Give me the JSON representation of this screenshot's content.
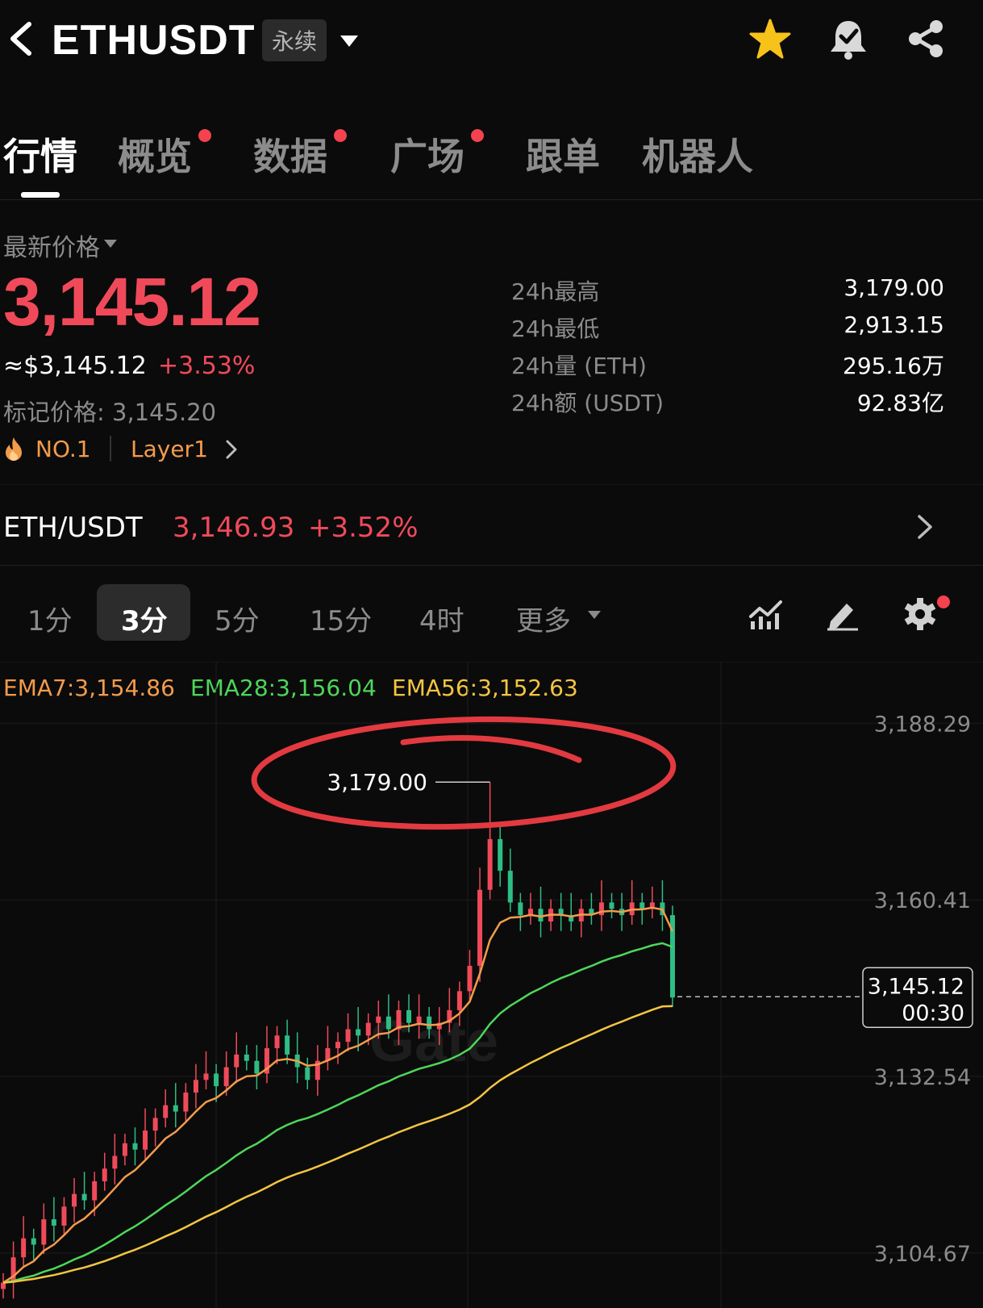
{
  "header": {
    "symbol": "ETHUSDT",
    "badge": "永续",
    "icons": [
      "back-icon",
      "dropdown-icon",
      "star-icon",
      "bell-check-icon",
      "share-icon"
    ]
  },
  "tabs": [
    {
      "label": "行情",
      "active": true,
      "dot": false
    },
    {
      "label": "概览",
      "active": false,
      "dot": true
    },
    {
      "label": "数据",
      "active": false,
      "dot": true
    },
    {
      "label": "广场",
      "active": false,
      "dot": true
    },
    {
      "label": "跟单",
      "active": false,
      "dot": false
    },
    {
      "label": "机器人",
      "active": false,
      "dot": false
    }
  ],
  "price": {
    "latest_label": "最新价格",
    "last": "3,145.12",
    "usd": "≈$3,145.12",
    "change_pct": "+3.53%",
    "mark": "标记价格: 3,145.20",
    "rank": "NO.1",
    "category": "Layer1"
  },
  "stats": [
    {
      "label": "24h最高",
      "value": "3,179.00"
    },
    {
      "label": "24h最低",
      "value": "2,913.15"
    },
    {
      "label": "24h量 (ETH)",
      "value": "295.16万"
    },
    {
      "label": "24h额 (USDT)",
      "value": "92.83亿"
    }
  ],
  "spot": {
    "pair": "ETH/USDT",
    "price": "3,146.93",
    "change_pct": "+3.52%"
  },
  "intervals": {
    "items": [
      "1分",
      "3分",
      "5分",
      "15分",
      "4时"
    ],
    "selected": "3分",
    "more": "更多"
  },
  "toolbar_icons": [
    "indicator-icon",
    "draw-icon",
    "gear-icon"
  ],
  "colors": {
    "up": "#f04a5a",
    "down": "#2ebd85",
    "ema7": "#f39b4c",
    "ema28": "#4ed65a",
    "ema56": "#f5c542",
    "accent_dot": "#f4424f",
    "star": "#f7c21a"
  },
  "chart_data": {
    "type": "candlestick",
    "interval": "3分",
    "indicators": [
      {
        "name": "EMA7",
        "label": "EMA7:3,154.86",
        "value": 3154.86
      },
      {
        "name": "EMA28",
        "label": "EMA28:3,156.04",
        "value": 3156.04
      },
      {
        "name": "EMA56",
        "label": "EMA56:3,152.63",
        "value": 3152.63
      }
    ],
    "y_ticks": [
      "3,188.29",
      "3,160.41",
      "3,132.54",
      "3,104.67"
    ],
    "y_tick_values": [
      3188.29,
      3160.41,
      3132.54,
      3104.67
    ],
    "ylim": [
      3096,
      3198
    ],
    "high_marker": {
      "label": "3,179.00",
      "value": 3179.0
    },
    "last_price": {
      "label": "3,145.12",
      "countdown": "00:30",
      "value": 3145.12
    },
    "watermark": "Gate",
    "close_series": [
      3100,
      3104,
      3107,
      3106,
      3110,
      3109,
      3112,
      3114,
      3113,
      3116,
      3118,
      3120,
      3122,
      3121,
      3124,
      3126,
      3128,
      3127,
      3130,
      3132,
      3133,
      3131,
      3134,
      3136,
      3135,
      3133,
      3137,
      3139,
      3136,
      3134,
      3132,
      3135,
      3137,
      3138,
      3140,
      3139,
      3141,
      3142,
      3140,
      3143,
      3141,
      3142,
      3140,
      3141,
      3143,
      3146,
      3150,
      3162,
      3170,
      3165,
      3160,
      3158,
      3159,
      3157,
      3159,
      3158,
      3157,
      3159,
      3158,
      3160,
      3159,
      3158,
      3160,
      3159,
      3160,
      3158,
      3145
    ]
  }
}
